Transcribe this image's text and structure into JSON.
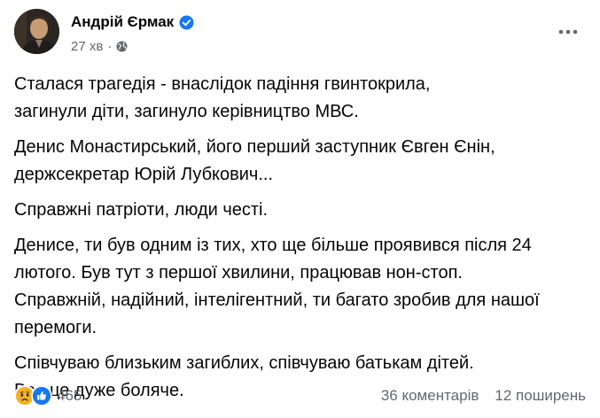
{
  "post": {
    "author": "Андрій Єрмак",
    "time": "27 хв",
    "separator": "·",
    "paragraphs": [
      "Сталася трагедія - внаслідок падіння гвинтокрила,\nзагинули діти, загинуло керівництво МВС.",
      "Денис Монастирський, його перший заступник Євген Єнін,\nдержсекретар Юрій Лубкович...",
      "Справжні патріоти, люди честі.",
      "Денисе, ти був одним із тих, хто ще більше проявився після 24\nлютого. Був тут з першої хвилини, працював нон-стоп.\nСправжній, надійний, інтелігентний, ти багато зробив для нашої\nперемоги.",
      "Співчуваю близьким загиблих, співчуваю батькам дітей.\nВсе це дуже боляче."
    ]
  },
  "reactions": {
    "count": "465",
    "icons": [
      "sad-icon",
      "like-icon"
    ]
  },
  "footer": {
    "comments": "36 коментарів",
    "shares": "12 поширень"
  },
  "colors": {
    "text": "#050505",
    "secondary": "#65676b",
    "verified": "#1877f2",
    "like": "#1877f2",
    "sad": "#f7b125"
  }
}
